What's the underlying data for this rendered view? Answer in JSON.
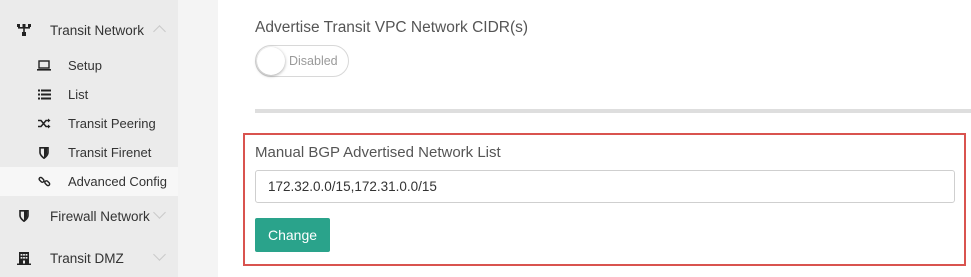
{
  "sidebar": {
    "transit_network": {
      "label": "Transit Network",
      "icon": "transit-network-icon"
    },
    "sub_items": [
      {
        "label": "Setup",
        "icon": "laptop-icon"
      },
      {
        "label": "List",
        "icon": "list-icon"
      },
      {
        "label": "Transit Peering",
        "icon": "shuffle-icon"
      },
      {
        "label": "Transit Firenet",
        "icon": "shield-icon"
      },
      {
        "label": "Advanced Config",
        "icon": "link-icon",
        "active": true
      }
    ],
    "firewall_network": {
      "label": "Firewall Network",
      "icon": "shield-icon"
    },
    "transit_dmz": {
      "label": "Transit DMZ",
      "icon": "building-icon"
    }
  },
  "main": {
    "advertise_cidr": {
      "label": "Advertise Transit VPC Network CIDR(s)",
      "toggle_label": "Disabled"
    },
    "bgp": {
      "label": "Manual BGP Advertised Network List",
      "input_value": "172.32.0.0/15,172.31.0.0/15",
      "button_label": "Change"
    }
  },
  "colors": {
    "accent_button": "#2aa38b",
    "highlight_border": "#d9534f",
    "sidebar_bg": "#ebebeb"
  }
}
